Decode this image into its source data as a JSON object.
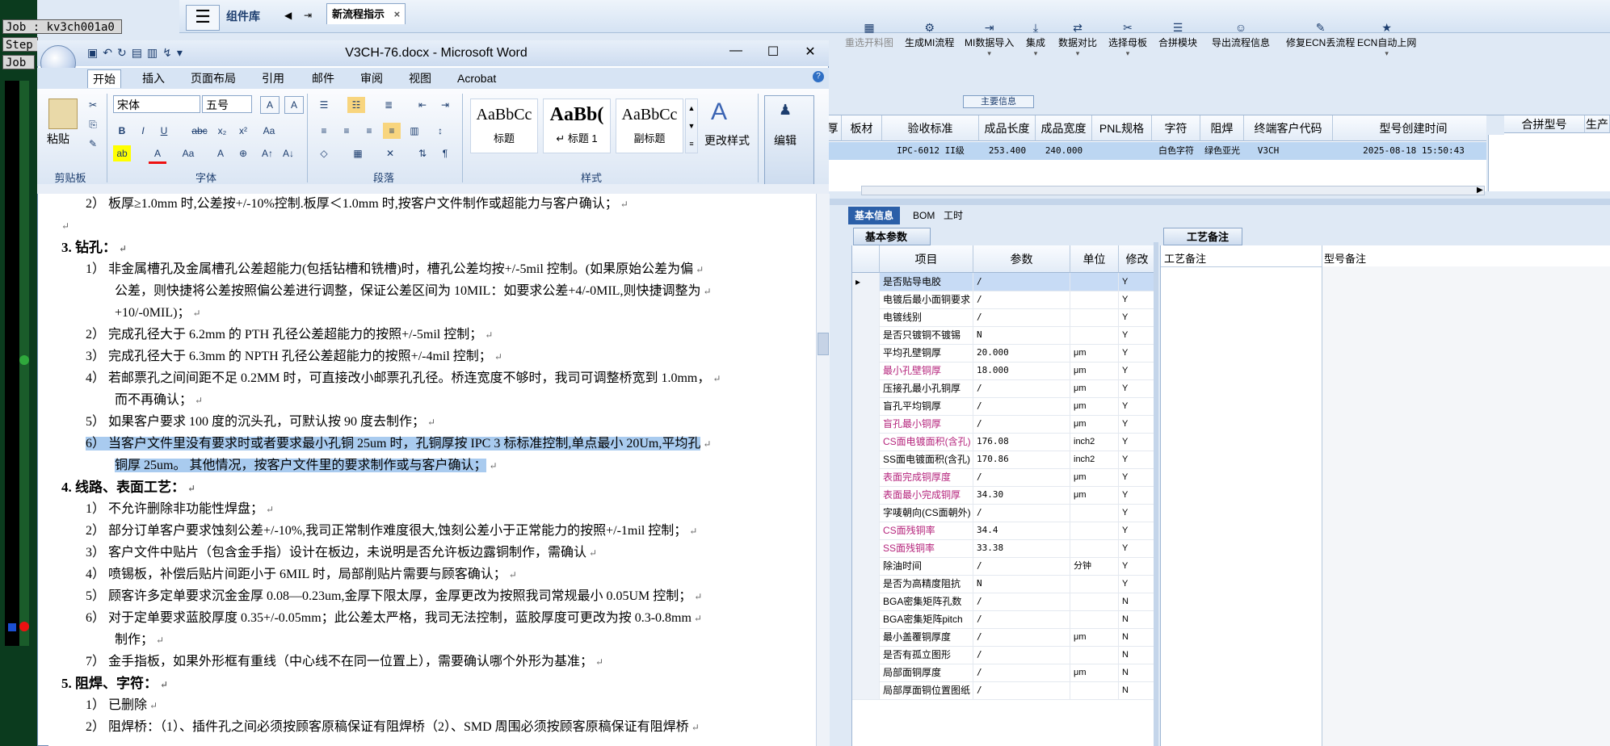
{
  "terminal": {
    "lines": [
      "Job : kv3ch001a0",
      "Step",
      "Job"
    ]
  },
  "app": {
    "panel_title": "组件库",
    "tab_label": "新流程指示",
    "tab_close": "×",
    "toolbar": [
      {
        "label": "重选开料图",
        "icon": "▦",
        "enabled": false
      },
      {
        "label": "生成MI流程",
        "icon": "⚙",
        "enabled": true
      },
      {
        "label": "MI数据导入",
        "icon": "⇥",
        "enabled": true
      },
      {
        "label": "集成",
        "icon": "⤓",
        "enabled": true
      },
      {
        "label": "数据对比",
        "icon": "⇄",
        "enabled": true
      },
      {
        "label": "选择母板",
        "icon": "✂",
        "enabled": true
      },
      {
        "label": "合拼模块",
        "icon": "☰",
        "enabled": true
      },
      {
        "label": "导出流程信息",
        "icon": "☺",
        "enabled": true
      },
      {
        "label": "修复ECN丢流程",
        "icon": "✎",
        "enabled": true
      },
      {
        "label": "ECN自动上网",
        "icon": "★",
        "enabled": true
      }
    ],
    "main_label": "主要信息",
    "grid": {
      "headers": [
        "厚",
        "板材",
        "验收标准",
        "成品长度",
        "成品宽度",
        "PNL规格",
        "字符",
        "阻焊",
        "终端客户代码",
        "型号创建时间",
        "合拼型号",
        "生产"
      ],
      "row": [
        "",
        "",
        "IPC-6012 II级",
        "253.400",
        "240.000",
        "",
        "白色字符",
        "绿色亚光",
        "V3CH",
        "2025-08-18 15:50:43",
        "",
        ""
      ]
    },
    "lower_tabs": [
      "基本信息",
      "BOM",
      "工时"
    ],
    "basic_param_tab": "基本参数",
    "param_headers": [
      "项目",
      "参数",
      "单位",
      "修改"
    ],
    "params": [
      {
        "item": "是否贴导电胶",
        "value": "/",
        "unit": "",
        "flag": "Y",
        "pink": false
      },
      {
        "item": "电镀后最小面铜要求",
        "value": "/",
        "unit": "",
        "flag": "Y",
        "pink": false
      },
      {
        "item": "电镀线别",
        "value": "/",
        "unit": "",
        "flag": "Y",
        "pink": false
      },
      {
        "item": "是否只镀铜不镀锡",
        "value": "N",
        "unit": "",
        "flag": "Y",
        "pink": false
      },
      {
        "item": "平均孔壁铜厚",
        "value": "20.000",
        "unit": "μm",
        "flag": "Y",
        "pink": false
      },
      {
        "item": "最小孔壁铜厚",
        "value": "18.000",
        "unit": "μm",
        "flag": "Y",
        "pink": true
      },
      {
        "item": "压接孔最小孔铜厚",
        "value": "/",
        "unit": "μm",
        "flag": "Y",
        "pink": false
      },
      {
        "item": "盲孔平均铜厚",
        "value": "/",
        "unit": "μm",
        "flag": "Y",
        "pink": false
      },
      {
        "item": "盲孔最小铜厚",
        "value": "/",
        "unit": "μm",
        "flag": "Y",
        "pink": true
      },
      {
        "item": "CS面电镀面积(含孔)",
        "value": "176.08",
        "unit": "inch2",
        "flag": "Y",
        "pink": true
      },
      {
        "item": "SS面电镀面积(含孔)",
        "value": "170.86",
        "unit": "inch2",
        "flag": "Y",
        "pink": false
      },
      {
        "item": "表面完成铜厚度",
        "value": "/",
        "unit": "μm",
        "flag": "Y",
        "pink": true
      },
      {
        "item": "表面最小完成铜厚",
        "value": "34.30",
        "unit": "μm",
        "flag": "Y",
        "pink": true
      },
      {
        "item": "字唛朝向(CS面朝外)",
        "value": "/",
        "unit": "",
        "flag": "Y",
        "pink": false
      },
      {
        "item": "CS面残铜率",
        "value": "34.4",
        "unit": "",
        "flag": "Y",
        "pink": true
      },
      {
        "item": "SS面残铜率",
        "value": "33.38",
        "unit": "",
        "flag": "Y",
        "pink": true
      },
      {
        "item": "除油时间",
        "value": "/",
        "unit": "分钟",
        "flag": "Y",
        "pink": false
      },
      {
        "item": "是否为高精度阻抗",
        "value": "N",
        "unit": "",
        "flag": "Y",
        "pink": false
      },
      {
        "item": "BGA密集矩阵孔数",
        "value": "/",
        "unit": "",
        "flag": "N",
        "pink": false
      },
      {
        "item": "BGA密集矩阵pitch",
        "value": "/",
        "unit": "",
        "flag": "N",
        "pink": false
      },
      {
        "item": "最小盖覆铜厚度",
        "value": "/",
        "unit": "μm",
        "flag": "N",
        "pink": false
      },
      {
        "item": "是否有孤立图形",
        "value": "/",
        "unit": "",
        "flag": "N",
        "pink": false
      },
      {
        "item": "局部面铜厚度",
        "value": "/",
        "unit": "μm",
        "flag": "N",
        "pink": false
      },
      {
        "item": "局部厚面铜位置图纸",
        "value": "/",
        "unit": "",
        "flag": "N",
        "pink": false
      }
    ],
    "craft_tab": "工艺备注",
    "craft_col1": "工艺备注",
    "craft_col2": "型号备注"
  },
  "word": {
    "title": "V3CH-76.docx - Microsoft Word",
    "ribbon_tabs": [
      "开始",
      "插入",
      "页面布局",
      "引用",
      "邮件",
      "审阅",
      "视图",
      "Acrobat"
    ],
    "font_name": "宋体",
    "font_size": "五号",
    "styles": [
      {
        "sample": "AaBbCc",
        "name": "标题"
      },
      {
        "sample": "AaBb(",
        "name": "↵ 标题 1"
      },
      {
        "sample": "AaBbCc",
        "name": "副标题"
      }
    ],
    "change_styles": "更改样式",
    "edit_label": "编辑",
    "paste_label": "粘贴",
    "groups": [
      "剪贴板",
      "字体",
      "段落",
      "样式"
    ],
    "doc_lines": [
      {
        "indent": 1,
        "text": "2） 板厚≥1.0mm 时,公差按+/-10%控制.板厚＜1.0mm 时,按客户文件制作或超能力与客户确认；",
        "bold": false,
        "hl": false
      },
      {
        "indent": 0,
        "text": "",
        "bold": false,
        "hl": false
      },
      {
        "indent": 0,
        "text": "3.   钻孔：",
        "bold": true,
        "hl": false
      },
      {
        "indent": 1,
        "text": "1） 非金属槽孔及金属槽孔公差超能力(包括钻槽和铣槽)时，槽孔公差均按+/-5mil 控制。(如果原始公差为偏",
        "bold": false,
        "hl": false
      },
      {
        "indent": 2,
        "text": "公差，则快捷将公差按照偏公差进行调整，保证公差区间为 10MIL：如要求公差+4/-0MIL,则快捷调整为",
        "bold": false,
        "hl": false
      },
      {
        "indent": 2,
        "text": "+10/-0MIL)；",
        "bold": false,
        "hl": false
      },
      {
        "indent": 1,
        "text": "2） 完成孔径大于 6.2mm 的 PTH 孔径公差超能力的按照+/-5mil 控制；",
        "bold": false,
        "hl": false
      },
      {
        "indent": 1,
        "text": "3） 完成孔径大于 6.3mm 的 NPTH 孔径公差超能力的按照+/-4mil 控制；",
        "bold": false,
        "hl": false
      },
      {
        "indent": 1,
        "text": "4） 若邮票孔之间间距不足 0.2MM 时，可直接改小邮票孔孔径。桥连宽度不够时，我司可调整桥宽到 1.0mm，",
        "bold": false,
        "hl": false
      },
      {
        "indent": 2,
        "text": "而不再确认；",
        "bold": false,
        "hl": false
      },
      {
        "indent": 1,
        "text": "5） 如果客户要求 100 度的沉头孔，可默认按 90 度去制作；",
        "bold": false,
        "hl": false
      },
      {
        "indent": 1,
        "text": "6） 当客户文件里没有要求时或者要求最小孔铜 25um 时，孔铜厚按 IPC 3 标标准控制,单点最小 20Um,平均孔",
        "bold": false,
        "hl": true
      },
      {
        "indent": 2,
        "text": "铜厚 25um。 其他情况，按客户文件里的要求制作或与客户确认；",
        "bold": false,
        "hl": true
      },
      {
        "indent": 0,
        "text": "4.   线路、表面工艺：",
        "bold": true,
        "hl": false
      },
      {
        "indent": 1,
        "text": "1） 不允许删除非功能性焊盘；",
        "bold": false,
        "hl": false
      },
      {
        "indent": 1,
        "text": "2） 部分订单客户要求蚀刻公差+/-10%,我司正常制作难度很大,蚀刻公差小于正常能力的按照+/-1mil 控制；",
        "bold": false,
        "hl": false
      },
      {
        "indent": 1,
        "text": "3） 客户文件中贴片（包含金手指）设计在板边，未说明是否允许板边露铜制作，需确认",
        "bold": false,
        "hl": false
      },
      {
        "indent": 1,
        "text": "4） 喷锡板，补偿后贴片间距小于 6MIL 时，局部削贴片需要与顾客确认；",
        "bold": false,
        "hl": false
      },
      {
        "indent": 1,
        "text": "5） 顾客许多定单要求沉金金厚 0.08—0.23um,金厚下限太厚，金厚更改为按照我司常规最小 0.05UM 控制；",
        "bold": false,
        "hl": false
      },
      {
        "indent": 1,
        "text": "6） 对于定单要求蓝胶厚度 0.35+/-0.05mm；此公差太严格，我司无法控制，蓝胶厚度可更改为按 0.3-0.8mm",
        "bold": false,
        "hl": false
      },
      {
        "indent": 2,
        "text": "制作；",
        "bold": false,
        "hl": false
      },
      {
        "indent": 1,
        "text": "7） 金手指板，如果外形框有重线（中心线不在同一位置上），需要确认哪个外形为基准；",
        "bold": false,
        "hl": false
      },
      {
        "indent": 0,
        "text": "5.   阻焊、字符：",
        "bold": true,
        "hl": false
      },
      {
        "indent": 1,
        "text": "1） 已删除",
        "bold": false,
        "hl": false
      },
      {
        "indent": 1,
        "text": "2） 阻焊桥：（1）、插件孔之间必须按顾客原稿保证有阻焊桥（2）、SMD 周围必须按顾客原稿保证有阻焊桥",
        "bold": false,
        "hl": false
      }
    ]
  }
}
